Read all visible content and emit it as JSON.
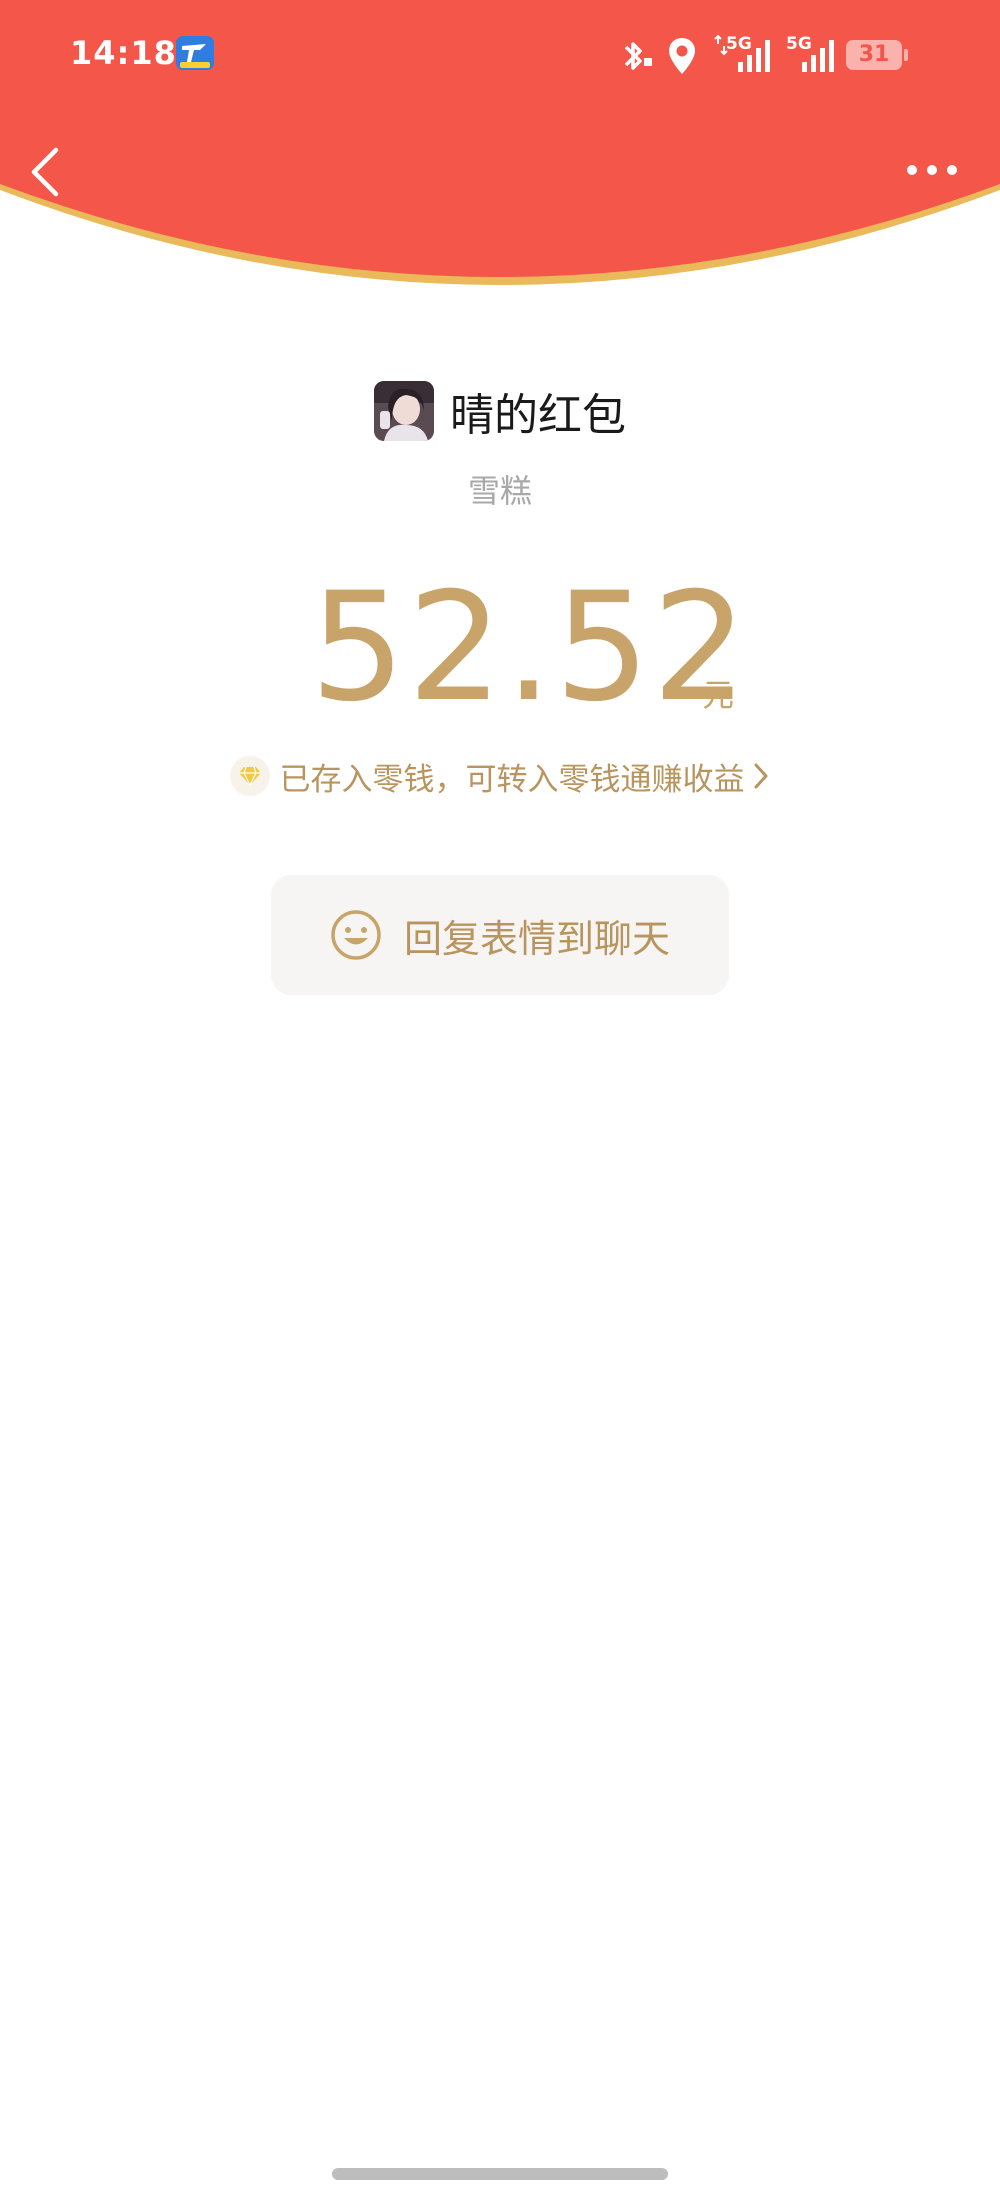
{
  "status_bar": {
    "time": "14:18",
    "signal_1_label": "5G",
    "signal_2_label": "5G",
    "battery": "31"
  },
  "colors": {
    "header_red": "#f4564a",
    "gold": "#c9a46a",
    "gold_text": "#b8955e",
    "gray_text": "#a8a8a8"
  },
  "nav": {
    "back_icon": "chevron-left-icon",
    "more_icon": "more-horizontal-icon"
  },
  "envelope": {
    "title": "晴的红包",
    "subtitle": "雪糕",
    "amount": "52.52",
    "unit": "元",
    "info_text": "已存入零钱，可转入零钱通赚收益",
    "reply_label": "回复表情到聊天"
  }
}
